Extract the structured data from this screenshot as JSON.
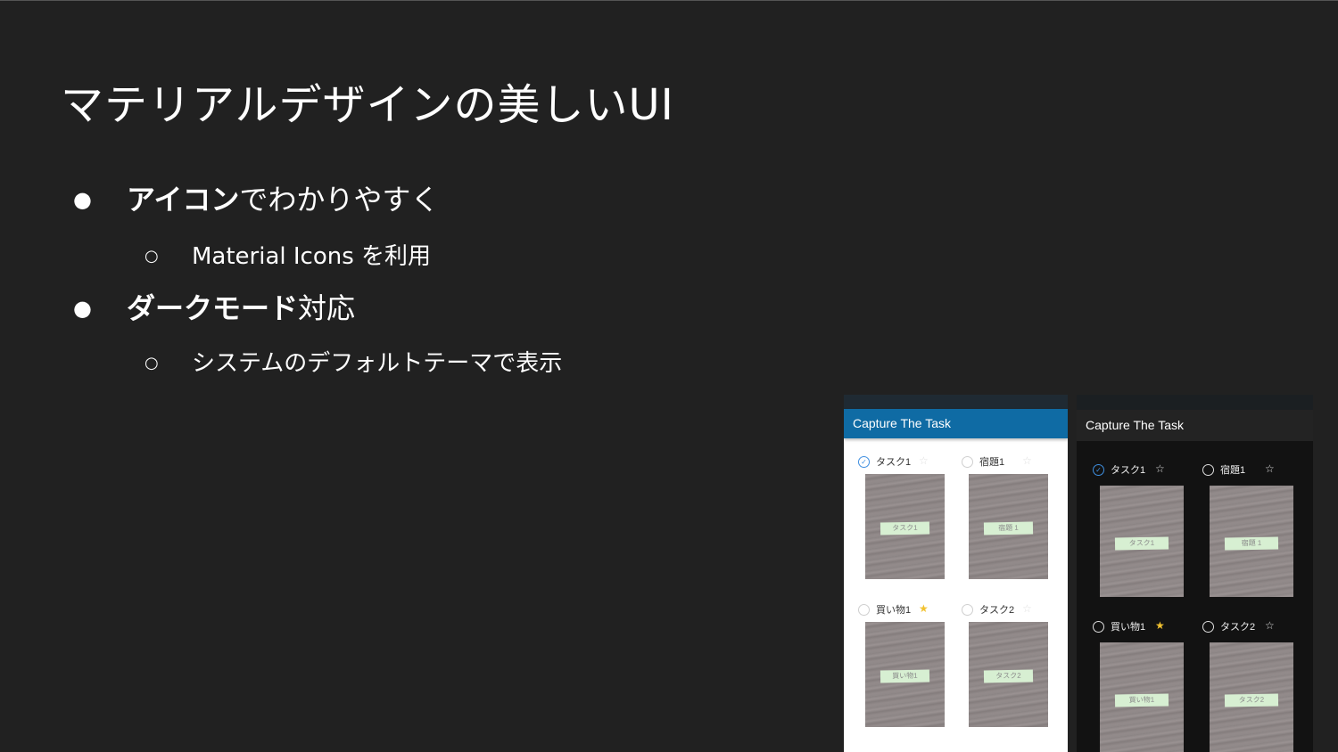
{
  "slide": {
    "title": "マテリアルデザインの美しいUI",
    "bullets": [
      {
        "bold": "アイコン",
        "rest": "でわかりやすく",
        "sub": "Material Icons を利用"
      },
      {
        "bold": "ダークモード",
        "rest": "対応",
        "sub": "システムのデフォルトテーマで表示"
      }
    ],
    "bullet_glyph": "●",
    "sub_glyph": "○"
  },
  "phones": {
    "app_title": "Capture The Task",
    "cards": [
      {
        "label": "タスク1",
        "note": "タスク1",
        "done": true,
        "starred": false
      },
      {
        "label": "宿題1",
        "note": "宿題 1",
        "done": false,
        "starred": false
      },
      {
        "label": "買い物1",
        "note": "買い物1",
        "done": false,
        "starred": true
      },
      {
        "label": "タスク2",
        "note": "タスク2",
        "done": false,
        "starred": false
      }
    ],
    "colors": {
      "light_appbar": "#0f6ba4",
      "dark_appbar": "#232323",
      "dark_background": "#121212",
      "star_active": "#f2c230",
      "check_active": "#3f8fe0"
    }
  }
}
